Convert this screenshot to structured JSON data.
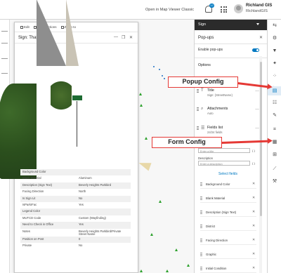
{
  "header": {
    "open_classic_label": "Open in Map Viewer Classic",
    "notifications_count": "12",
    "org_name": "Richland GIS",
    "username": "RichlandGIS"
  },
  "popup": {
    "toolbar": {
      "edit": "Edit",
      "directions": "Get directions",
      "zoom": "Zoom to"
    },
    "title": "Sign: Thayer Dr",
    "attributes": [
      {
        "key": "Background Color",
        "value": ""
      },
      {
        "key": "Blank Material",
        "value": "Aluminum"
      },
      {
        "key": "Description (Sign Text)",
        "value": "Beverly Heights Parkbird"
      },
      {
        "key": "Facing Direction",
        "value": "North"
      },
      {
        "key": "Is Sign Lit",
        "value": "No"
      },
      {
        "key": "IsParkrFac",
        "value": "Yes"
      },
      {
        "key": "Legend Color",
        "value": ""
      },
      {
        "key": "MUTCD Code",
        "value": "Custom (Wayfinding)"
      },
      {
        "key": "Need to Check in Office",
        "value": "Yes"
      },
      {
        "key": "Notes",
        "value": "Beverly Heights Parkbird/Private Street Name"
      },
      {
        "key": "Position on Post",
        "value": "0"
      },
      {
        "key": "Private",
        "value": "No"
      }
    ]
  },
  "config_panel": {
    "breadcrumb": "Sign",
    "section_title": "Pop-ups",
    "enable_label": "Enable pop-ups",
    "enable_on": true,
    "options_label": "Options",
    "items": [
      {
        "name": "Title",
        "sub": "Sign: {StreetName}"
      },
      {
        "name": "Attachments",
        "sub": "Auto"
      },
      {
        "name": "Fields list",
        "sub": "24/24 fields"
      }
    ],
    "title_placeholder": "Enter a title",
    "description_label": "Description",
    "description_placeholder": "Enter a description",
    "select_fields_label": "Select fields",
    "field_list": [
      "Background Color",
      "Blank Material",
      "Description (Sign Text)",
      "District",
      "Facing Direction",
      "Graphic",
      "Initial Condition"
    ]
  },
  "annotations": {
    "popup_config": "Popup Config",
    "form_config": "Form Config",
    "color": "#e53935"
  }
}
